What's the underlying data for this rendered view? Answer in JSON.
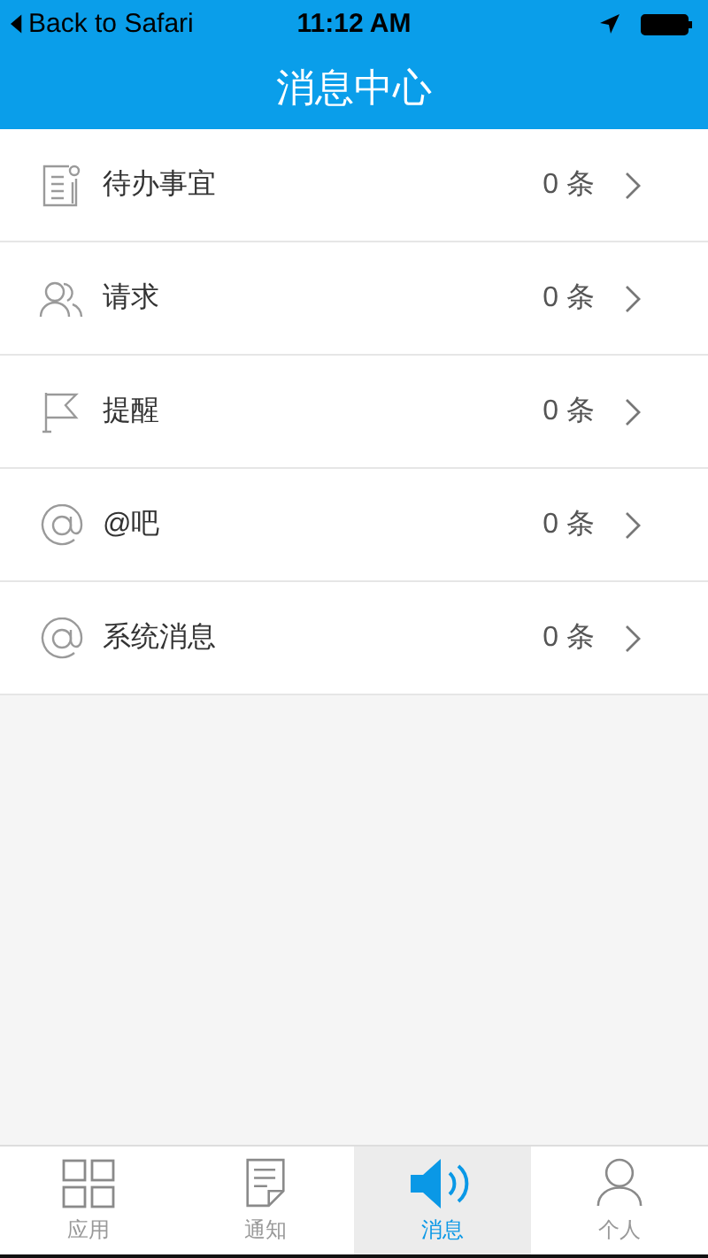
{
  "status_bar": {
    "back": "Back to Safari",
    "time": "11:12 AM"
  },
  "nav": {
    "title": "消息中心"
  },
  "items": [
    {
      "kind": "todo",
      "label": "待办事宜",
      "count": "0 条"
    },
    {
      "kind": "people",
      "label": "请求",
      "count": "0 条"
    },
    {
      "kind": "flag",
      "label": "提醒",
      "count": "0 条"
    },
    {
      "kind": "at",
      "label": "@吧",
      "count": "0 条"
    },
    {
      "kind": "at",
      "label": "系统消息",
      "count": "0 条"
    }
  ],
  "tabs": [
    {
      "kind": "grid",
      "label": "应用",
      "selected": false
    },
    {
      "kind": "note",
      "label": "通知",
      "selected": false
    },
    {
      "kind": "speaker",
      "label": "消息",
      "selected": true
    },
    {
      "kind": "person",
      "label": "个人",
      "selected": false
    }
  ]
}
